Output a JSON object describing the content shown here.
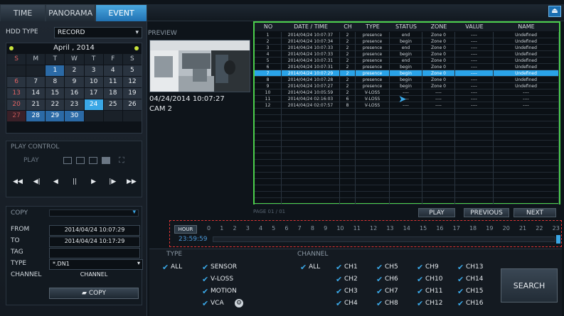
{
  "tabs": [
    {
      "label": "TIME",
      "active": false
    },
    {
      "label": "PANORAMA",
      "active": false
    },
    {
      "label": "EVENT",
      "active": true
    }
  ],
  "exit_icon": "exit-icon",
  "hdd": {
    "label": "HDD TYPE",
    "value": "RECORD"
  },
  "calendar": {
    "month_label": "April , 2014",
    "weekdays": [
      "S",
      "M",
      "T",
      "W",
      "T",
      "F",
      "S"
    ],
    "rows": [
      [
        {
          "d": ""
        },
        {
          "d": ""
        },
        {
          "d": "1",
          "s": "has"
        },
        {
          "d": "2"
        },
        {
          "d": "3"
        },
        {
          "d": "4"
        },
        {
          "d": "5"
        }
      ],
      [
        {
          "d": "6",
          "s": "sun"
        },
        {
          "d": "7"
        },
        {
          "d": "8"
        },
        {
          "d": "9"
        },
        {
          "d": "10"
        },
        {
          "d": "11"
        },
        {
          "d": "12"
        }
      ],
      [
        {
          "d": "13",
          "s": "sun"
        },
        {
          "d": "14"
        },
        {
          "d": "15"
        },
        {
          "d": "16"
        },
        {
          "d": "17"
        },
        {
          "d": "18"
        },
        {
          "d": "19"
        }
      ],
      [
        {
          "d": "20",
          "s": "sun"
        },
        {
          "d": "21"
        },
        {
          "d": "22"
        },
        {
          "d": "23"
        },
        {
          "d": "24",
          "s": "sel"
        },
        {
          "d": "25"
        },
        {
          "d": "26"
        }
      ],
      [
        {
          "d": "27",
          "s": "other"
        },
        {
          "d": "28",
          "s": "has"
        },
        {
          "d": "29",
          "s": "has"
        },
        {
          "d": "30",
          "s": "has"
        },
        {
          "d": ""
        },
        {
          "d": ""
        },
        {
          "d": ""
        }
      ]
    ]
  },
  "play_control": {
    "title": "PLAY CONTROL",
    "play_label": "PLAY",
    "buttons": [
      "◀◀",
      "◀|",
      "◀",
      "||",
      "▶",
      "|▶",
      "▶▶"
    ]
  },
  "copy": {
    "title": "COPY",
    "from_label": "FROM",
    "from_value": "2014/04/24 10:07:29",
    "to_label": "TO",
    "to_value": "2014/04/24 10:17:29",
    "tag_label": "TAG",
    "tag_value": "",
    "type_label": "TYPE",
    "type_value": "*.DN1",
    "channel_label": "CHANNEL",
    "channel_value": "CHANNEL",
    "copy_button": "COPY"
  },
  "preview": {
    "label": "PREVIEW",
    "timestamp": "04/24/2014 10:07:27",
    "camera": "CAM 2"
  },
  "table": {
    "headers": [
      "NO",
      "DATE / TIME",
      "CH",
      "TYPE",
      "STATUS",
      "ZONE",
      "VALUE",
      "NAME"
    ],
    "rows": [
      [
        "1",
        "2014/04/24 10:07:37",
        "2",
        "presence",
        "end",
        "Zone 0",
        "----",
        "Undefined"
      ],
      [
        "2",
        "2014/04/24 10:07:34",
        "2",
        "presence",
        "begin",
        "Zone 0",
        "----",
        "Undefined"
      ],
      [
        "3",
        "2014/04/24 10:07:33",
        "2",
        "presence",
        "end",
        "Zone 0",
        "----",
        "Undefined"
      ],
      [
        "4",
        "2014/04/24 10:07:33",
        "2",
        "presence",
        "begin",
        "Zone 0",
        "----",
        "Undefined"
      ],
      [
        "5",
        "2014/04/24 10:07:31",
        "2",
        "presence",
        "end",
        "Zone 0",
        "----",
        "Undefined"
      ],
      [
        "6",
        "2014/04/24 10:07:31",
        "2",
        "presence",
        "begin",
        "Zone 0",
        "----",
        "Undefined"
      ],
      [
        "7",
        "2014/04/24 10:07:29",
        "2",
        "presence",
        "begin",
        "Zone 0",
        "----",
        "Undefined"
      ],
      [
        "8",
        "2014/04/24 10:07:28",
        "2",
        "presence",
        "begin",
        "Zone 0",
        "----",
        "Undefined"
      ],
      [
        "9",
        "2014/04/24 10:07:27",
        "2",
        "presence",
        "begin",
        "Zone 0",
        "----",
        "Undefined"
      ],
      [
        "10",
        "2014/04/24 10:05:59",
        "2",
        "V-LOSS",
        "----",
        "----",
        "----",
        "----"
      ],
      [
        "11",
        "2014/04/24 02:16:03",
        "6",
        "V-LOSS",
        "----",
        "----",
        "----",
        "----"
      ],
      [
        "12",
        "2014/04/24 02:07:57",
        "8",
        "V-LOSS",
        "----",
        "----",
        "----",
        "----"
      ]
    ],
    "selected_index": 6,
    "page_label": "PAGE 01 / 01"
  },
  "nav": {
    "play": "PLAY",
    "previous": "PREVIOUS",
    "next": "NEXT"
  },
  "timeline": {
    "hour_button": "HOUR",
    "hours": [
      "0",
      "1",
      "2",
      "3",
      "4",
      "5",
      "6",
      "7",
      "8",
      "9",
      "10",
      "11",
      "12",
      "13",
      "14",
      "15",
      "16",
      "17",
      "18",
      "19",
      "20",
      "21",
      "22",
      "23"
    ],
    "time_text": "23:59:59"
  },
  "type": {
    "title": "TYPE",
    "all": "ALL",
    "items": [
      "SENSOR",
      "V-LOSS",
      "MOTION",
      "VCA"
    ]
  },
  "channel": {
    "title": "CHANNEL",
    "all": "ALL",
    "items": [
      "CH1",
      "CH5",
      "CH9",
      "CH13",
      "CH2",
      "CH6",
      "CH10",
      "CH14",
      "CH3",
      "CH7",
      "CH11",
      "CH15",
      "CH4",
      "CH8",
      "CH12",
      "CH16"
    ]
  },
  "search": "SEARCH",
  "colors": {
    "accent": "#3aa7e6",
    "grid_border": "#4ccf4c",
    "timeline_border": "#dd3333"
  }
}
